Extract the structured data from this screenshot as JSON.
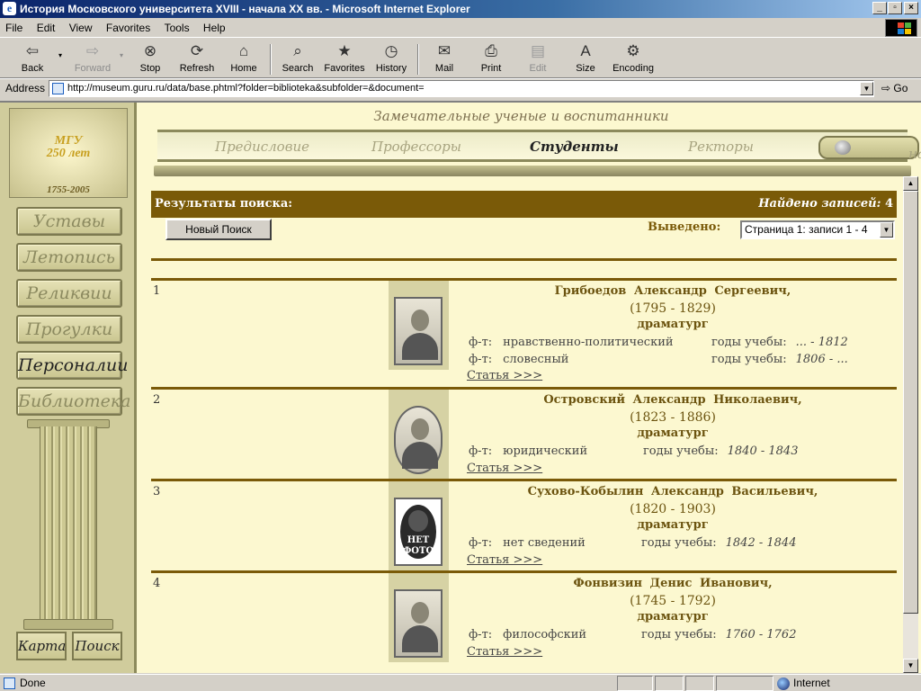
{
  "window": {
    "title": "История Московского университета XVIII - начала XX вв. - Microsoft Internet Explorer"
  },
  "menu": [
    "File",
    "Edit",
    "View",
    "Favorites",
    "Tools",
    "Help"
  ],
  "toolbar": {
    "back": "Back",
    "forward": "Forward",
    "stop": "Stop",
    "refresh": "Refresh",
    "home": "Home",
    "search": "Search",
    "favorites": "Favorites",
    "history": "History",
    "mail": "Mail",
    "print": "Print",
    "edit": "Edit",
    "size": "Size",
    "encoding": "Encoding"
  },
  "address": {
    "label": "Address",
    "url": "http://museum.guru.ru/data/base.phtml?folder=biblioteka&subfolder=&document=",
    "go": "Go"
  },
  "logo": {
    "line1": "МГУ",
    "line2": "250 лет",
    "line3": "1755-2005"
  },
  "sidebar": {
    "items": [
      "Уставы",
      "Летопись",
      "Реликвии",
      "Прогулки",
      "Персоналии",
      "Библиотека"
    ],
    "active": "Персоналии",
    "bottom": [
      "Карта",
      "Поиск"
    ]
  },
  "page": {
    "heading": "Замечательные ученые и воспитанники",
    "nav": [
      "Предисловие",
      "Профессоры",
      "Студенты",
      "Ректоры"
    ],
    "nav_active": "Студенты",
    "back": "назад"
  },
  "results": {
    "label": "Результаты поиска:",
    "found_label": "Найдено записей:",
    "found_count": "4",
    "new_search": "Новый Поиск",
    "shown_label": "Выведено:",
    "page_select": "Страница 1: записи 1 - 4"
  },
  "records": [
    {
      "num": "1",
      "name": "Грибоедов Александр Сергеевич,",
      "dates": "(1795 - 1829)",
      "profession": "драматург",
      "faculties": [
        {
          "label": "ф-т:",
          "value": "нравственно-политический",
          "years_label": "годы учебы:",
          "years_from": "...",
          "years_to": "1812"
        },
        {
          "label": "ф-т:",
          "value": "словесный",
          "years_label": "годы учебы:",
          "years_from": "1806",
          "years_to": "..."
        }
      ],
      "link": "Статья >>>",
      "photo": true
    },
    {
      "num": "2",
      "name": "Островский Александр Николаевич,",
      "dates": "(1823 - 1886)",
      "profession": "драматург",
      "faculties": [
        {
          "label": "ф-т:",
          "value": "юридический",
          "years_label": "годы учебы:",
          "years_from": "1840",
          "years_to": "1843"
        }
      ],
      "link": "Статья >>>",
      "photo": true
    },
    {
      "num": "3",
      "name": "Сухово-Кобылин Александр Васильевич,",
      "dates": "(1820 - 1903)",
      "profession": "драматург",
      "faculties": [
        {
          "label": "ф-т:",
          "value": "нет сведений",
          "years_label": "годы учебы:",
          "years_from": "1842",
          "years_to": "1844"
        }
      ],
      "link": "Статья >>>",
      "photo": false,
      "nophoto": [
        "НЕТ",
        "ФОТО"
      ]
    },
    {
      "num": "4",
      "name": "Фонвизин Денис Иванович,",
      "dates": "(1745 - 1792)",
      "profession": "драматург",
      "faculties": [
        {
          "label": "ф-т:",
          "value": "философский",
          "years_label": "годы учебы:",
          "years_from": "1760",
          "years_to": "1762"
        }
      ],
      "link": "Статья >>>",
      "photo": true
    }
  ],
  "status": {
    "left": "Done",
    "zone": "Internet"
  }
}
